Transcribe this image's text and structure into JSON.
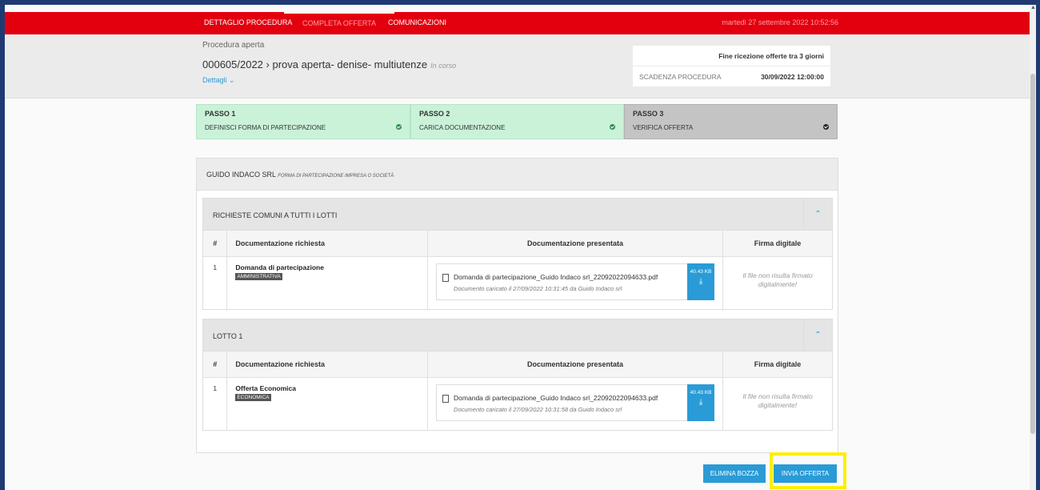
{
  "nav": {
    "tabs": [
      {
        "label": "DETTAGLIO PROCEDURA",
        "active": false
      },
      {
        "label": "COMPLETA OFFERTA",
        "active": true
      },
      {
        "label": "COMUNICAZIONI",
        "active": false
      }
    ],
    "datetime": "martedì 27 settembre 2022 10:52:56"
  },
  "header": {
    "type_label": "Procedura aperta",
    "code": "000605/2022",
    "title": "prova aperta- denise- multiutenze",
    "status": "In corso",
    "details_link": "Dettagli"
  },
  "deadline": {
    "countdown": "Fine ricezione offerte tra 3 giorni",
    "label": "SCADENZA PROCEDURA",
    "value": "30/09/2022 12:00:00"
  },
  "steps": [
    {
      "number": "PASSO 1",
      "label": "DEFINISCI FORMA DI PARTECIPAZIONE",
      "state": "done"
    },
    {
      "number": "PASSO 2",
      "label": "CARICA DOCUMENTAZIONE",
      "state": "done"
    },
    {
      "number": "PASSO 3",
      "label": "VERIFICA OFFERTA",
      "state": "current"
    }
  ],
  "company": {
    "name": "GUIDO INDACO SRL",
    "participation": "FORMA DI PARTECIPAZIONE IMPRESA O SOCIETÀ"
  },
  "table_headers": {
    "num": "#",
    "required": "Documentazione richiesta",
    "presented": "Documentazione presentata",
    "signature": "Firma digitale"
  },
  "sections": [
    {
      "title": "RICHIESTE COMUNI A TUTTI I LOTTI",
      "rows": [
        {
          "num": "1",
          "doc": "Domanda di partecipazione",
          "tag": "AMMINISTRATIVA",
          "file": "Domanda di partecipazione_Guido Indaco srl_22092022094633.pdf",
          "meta": "Documento caricato il 27/09/2022 10:31:45 da Guido Indaco srl",
          "size": "40.43 KB",
          "signature": "Il file non risulta firmato digitalmente!"
        }
      ]
    },
    {
      "title": "LOTTO 1",
      "rows": [
        {
          "num": "1",
          "doc": "Offerta Economica",
          "tag": "ECONOMICA",
          "file": "Domanda di partecipazione_Guido Indaco srl_22092022094633.pdf",
          "meta": "Documento caricato il 27/09/2022 10:31:58 da Guido Indaco srl",
          "size": "40.43 KB",
          "signature": "Il file non risulta firmato digitalmente!"
        }
      ]
    }
  ],
  "actions": {
    "delete_draft": "ELIMINA BOZZA",
    "send_offer": "INVIA OFFERTA"
  }
}
